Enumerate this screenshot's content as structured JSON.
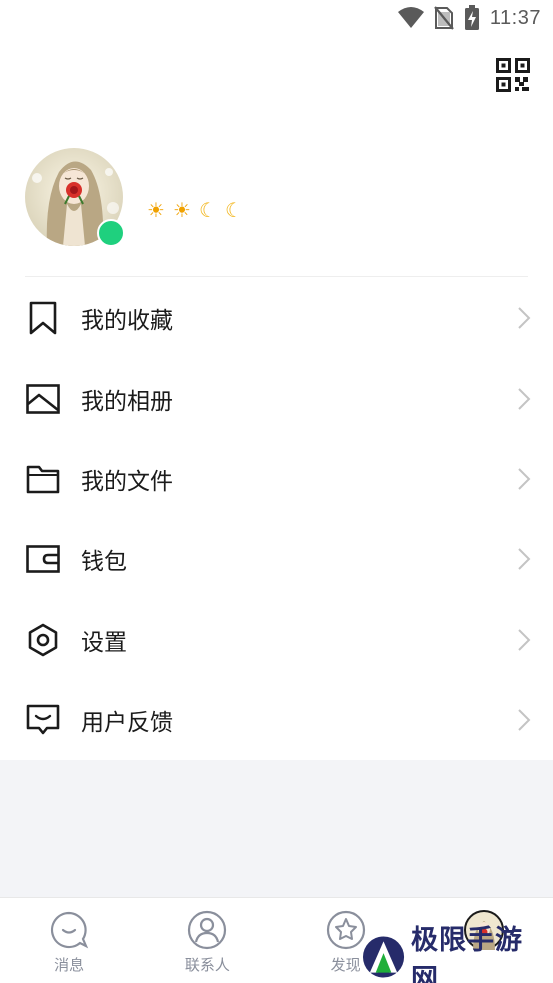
{
  "status_bar": {
    "time": "11:37",
    "icons": [
      "wifi-icon",
      "no-sim-icon",
      "battery-charging-icon"
    ]
  },
  "header": {
    "qr_icon": "qr-code-icon"
  },
  "profile": {
    "avatar_icon": "avatar-image",
    "online_status_color": "#1fd07e",
    "level_badges": [
      "☀",
      "☀",
      "☾",
      "☾"
    ]
  },
  "menu": {
    "items": [
      {
        "label": "我的收藏",
        "icon": "bookmark-icon"
      },
      {
        "label": "我的相册",
        "icon": "image-icon"
      },
      {
        "label": "我的文件",
        "icon": "folder-icon"
      },
      {
        "label": "钱包",
        "icon": "wallet-icon"
      },
      {
        "label": "设置",
        "icon": "settings-icon"
      },
      {
        "label": "用户反馈",
        "icon": "feedback-icon"
      }
    ]
  },
  "tab_bar": {
    "tabs": [
      {
        "label": "消息",
        "icon": "message-icon"
      },
      {
        "label": "联系人",
        "icon": "contacts-icon"
      },
      {
        "label": "发现",
        "icon": "discover-icon"
      },
      {
        "label": "",
        "icon": "profile-avatar-icon"
      }
    ]
  },
  "watermark": {
    "text": "极限手游网"
  },
  "colors": {
    "accent_online": "#1fd07e",
    "tab_label": "#8a8f9c",
    "background_gray": "#f3f4f7",
    "watermark_navy": "#262b6a",
    "watermark_green": "#1fae3a"
  }
}
